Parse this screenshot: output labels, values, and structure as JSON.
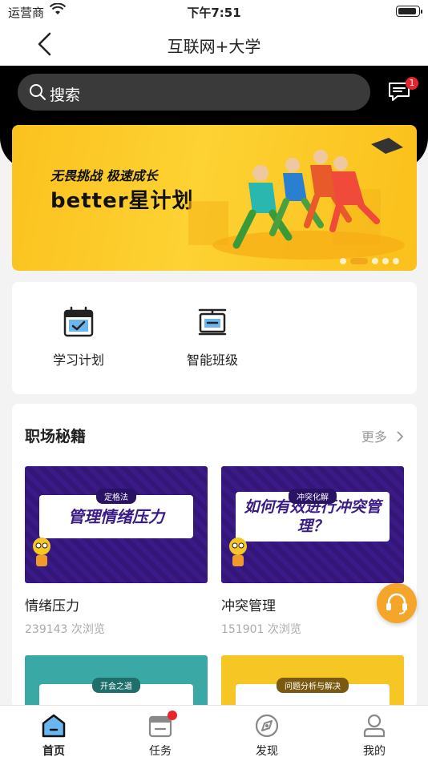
{
  "status_bar": {
    "carrier": "运营商",
    "time": "下午7:51"
  },
  "nav": {
    "title": "互联网+大学"
  },
  "search": {
    "placeholder": "搜索"
  },
  "messages": {
    "badge": "1"
  },
  "banner": {
    "slogan": "无畏挑战 极速成长",
    "brand": "better星计划",
    "slide_count": 5,
    "active_slide": 2
  },
  "quick_entries": [
    {
      "label": "学习计划",
      "icon": "calendar-check-icon"
    },
    {
      "label": "智能班级",
      "icon": "class-board-icon"
    }
  ],
  "section": {
    "title": "职场秘籍",
    "more_label": "更多",
    "courses": [
      {
        "tag": "定格法",
        "cover_text": "管理情绪压力",
        "name": "情绪压力",
        "views": "239143 次浏览"
      },
      {
        "tag": "冲突化解",
        "cover_text": "如何有效进行冲突管理？",
        "name": "冲突管理",
        "views": "151901 次浏览"
      },
      {
        "tag": "开会之道",
        "cover_text": "",
        "name": "",
        "views": ""
      },
      {
        "tag": "问题分析与解决",
        "cover_text": "",
        "name": "",
        "views": ""
      }
    ]
  },
  "tabbar": [
    {
      "label": "首页",
      "icon": "home-icon",
      "active": true
    },
    {
      "label": "任务",
      "icon": "task-icon",
      "active": false,
      "has_dot": true
    },
    {
      "label": "发现",
      "icon": "discover-icon",
      "active": false
    },
    {
      "label": "我的",
      "icon": "profile-icon",
      "active": false
    }
  ],
  "colors": {
    "accent": "#f4a52a",
    "badge": "#e8232b",
    "banner": "#fbc21e",
    "cover_purple": "#3a1a86"
  }
}
